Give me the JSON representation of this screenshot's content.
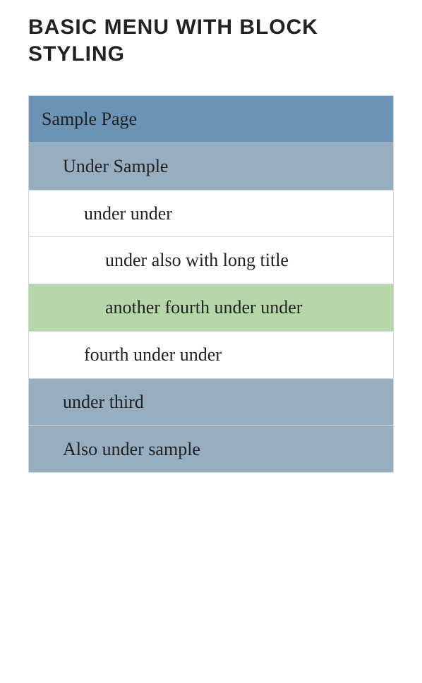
{
  "heading": "BASIC MENU WITH BLOCK STYLING",
  "menu": {
    "items": [
      {
        "label": "Sample Page",
        "level": 0,
        "style": "blue-dark"
      },
      {
        "label": "Under Sample",
        "level": 1,
        "style": "blue-light"
      },
      {
        "label": "under under",
        "level": 2,
        "style": "white"
      },
      {
        "label": "under also with long title",
        "level": 3,
        "style": "white"
      },
      {
        "label": "another fourth under under",
        "level": 3,
        "style": "green"
      },
      {
        "label": "fourth under under",
        "level": 2,
        "style": "white"
      },
      {
        "label": "under third",
        "level": 1,
        "style": "blue-light"
      },
      {
        "label": "Also under sample",
        "level": 1,
        "style": "blue-light"
      }
    ]
  }
}
